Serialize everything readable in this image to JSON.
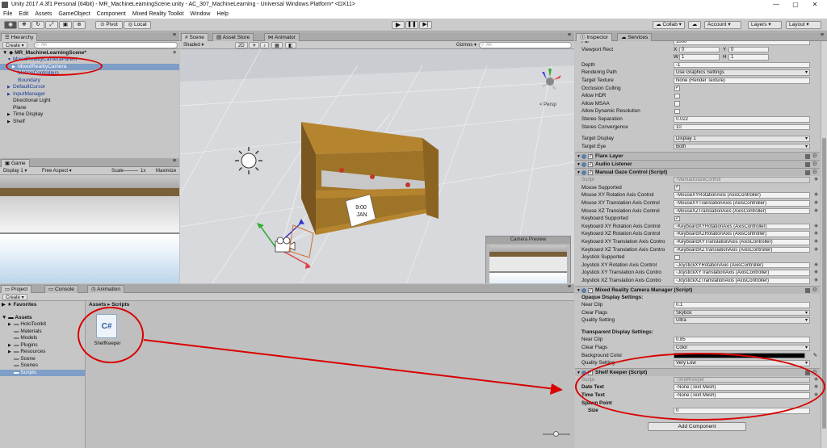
{
  "window": {
    "title": "Unity 2017.4.3f1 Personal (64bit) - MR_MachineLearningScene.unity - AC_307_MachineLearning - Universal Windows Platform* <DX11>",
    "controls": [
      "—",
      "▢",
      "✕"
    ]
  },
  "menubar": [
    "File",
    "Edit",
    "Assets",
    "GameObject",
    "Component",
    "Mixed Reality Toolkit",
    "Window",
    "Help"
  ],
  "toolbar": {
    "pivot": "Pivot",
    "local": "Local",
    "collab": "Collab ▾",
    "account": "Account",
    "layers": "Layers",
    "layout": "Layout"
  },
  "hierarchy": {
    "tab": "Hierarchy",
    "create": "Create ▾",
    "search_placeholder": "All",
    "scene": "MR_MachineLearningScene*",
    "items": [
      {
        "label": "MixedRealityCameraParent",
        "indent": 1,
        "blue": true,
        "arrow": "▼"
      },
      {
        "label": "MixedRealityCamera",
        "indent": 2,
        "blue": true,
        "arrow": "▶",
        "selected": true
      },
      {
        "label": "MotionControllers",
        "indent": 2,
        "blue": true,
        "arrow": ""
      },
      {
        "label": "Boundary",
        "indent": 2,
        "blue": true,
        "arrow": ""
      },
      {
        "label": "DefaultCursor",
        "indent": 1,
        "blue": true,
        "arrow": "▶"
      },
      {
        "label": "InputManager",
        "indent": 1,
        "blue": true,
        "arrow": "▶"
      },
      {
        "label": "Directional Light",
        "indent": 1,
        "blue": false,
        "arrow": ""
      },
      {
        "label": "Plane",
        "indent": 1,
        "blue": false,
        "arrow": ""
      },
      {
        "label": "Time Display",
        "indent": 1,
        "blue": false,
        "arrow": "▶"
      },
      {
        "label": "Shelf",
        "indent": 1,
        "blue": false,
        "arrow": "▶"
      }
    ]
  },
  "game": {
    "tab": "Game",
    "display": "Display 1",
    "aspect": "Free Aspect",
    "scale_label": "Scale",
    "scale_value": "1x",
    "maximize": "Maximize"
  },
  "scene": {
    "tabs": [
      "Scene",
      "Asset Store",
      "Animator"
    ],
    "shaded": "Shaded",
    "mode_2d": "2D",
    "gizmos": "Gizmos ▾",
    "search_placeholder": "All",
    "sign_time": "9:00",
    "sign_month": "JAN",
    "camera_preview": "Camera Preview",
    "persp": "< Persp"
  },
  "project": {
    "tabs": [
      "Project",
      "Console",
      "Animation"
    ],
    "create": "Create ▾",
    "favorites": "Favorites",
    "assets": "Assets",
    "folders": [
      "HoloToolkit",
      "Materials",
      "Models",
      "Plugins",
      "Resources",
      "Scene",
      "Scenes",
      "Scripts"
    ],
    "breadcrumb": "Assets ▸ Scripts",
    "file_name": "ShelfKeeper",
    "file_glyph": "C#"
  },
  "inspector": {
    "tabs": [
      "Inspector",
      "Services"
    ],
    "top_rows": [
      {
        "label": "Far",
        "value": "1000",
        "type": "text"
      },
      {
        "label": "Viewport Rect",
        "value": "",
        "type": "rect"
      },
      {
        "label": "Depth",
        "value": "-1",
        "type": "text"
      },
      {
        "label": "Rendering Path",
        "value": "Use Graphics Settings",
        "type": "drop"
      },
      {
        "label": "Target Texture",
        "value": "None (Render Texture)",
        "type": "text"
      },
      {
        "label": "Occlusion Culling",
        "value": "✓",
        "type": "check"
      },
      {
        "label": "Allow HDR",
        "value": "",
        "type": "check"
      },
      {
        "label": "Allow MSAA",
        "value": "",
        "type": "check"
      },
      {
        "label": "Allow Dynamic Resolution",
        "value": "",
        "type": "check"
      },
      {
        "label": "Stereo Separation",
        "value": "0.022",
        "type": "text"
      },
      {
        "label": "Stereo Convergence",
        "value": "10",
        "type": "text"
      },
      {
        "label": "",
        "value": "",
        "type": "gap"
      },
      {
        "label": "Target Display",
        "value": "Display 1",
        "type": "drop"
      },
      {
        "label": "Target Eye",
        "value": "Both",
        "type": "drop"
      }
    ],
    "viewport": {
      "x_label": "X",
      "x": "0",
      "y_label": "Y",
      "y": "0",
      "w_label": "W",
      "w": "1",
      "h_label": "H",
      "h": "1"
    },
    "flare_layer": "Flare Layer",
    "audio_listener": "Audio Listener",
    "gaze_title": "Manual Gaze Control (Script)",
    "gaze_rows": [
      {
        "label": "Script",
        "value": "ManualGazeControl",
        "type": "script"
      },
      {
        "label": "Mouse Supported",
        "value": "✓",
        "type": "check"
      },
      {
        "label": "Mouse XY Rotation Axis Control",
        "value": "MouseXYRotationAxis (AxisController)",
        "type": "obj"
      },
      {
        "label": "Mouse XY Translation Axis Control",
        "value": "MouseXYTranslationAxis (AxisController)",
        "type": "obj"
      },
      {
        "label": "Mouse XZ Translation Axis Control",
        "value": "MouseXZTranslationAxis (AxisController)",
        "type": "obj"
      },
      {
        "label": "Keyboard Supported",
        "value": "✓",
        "type": "check"
      },
      {
        "label": "Keyboard XY Rotation Axis Control",
        "value": "KeyboardXYRotationAxis (AxisController)",
        "type": "obj"
      },
      {
        "label": "Keyboard XZ Rotation Axis Control",
        "value": "KeyboardXZRotationAxis (AxisController)",
        "type": "obj"
      },
      {
        "label": "Keyboard XY Translation Axis Contro",
        "value": "KeyboardXYTranslationAxis (AxisController)",
        "type": "obj"
      },
      {
        "label": "Keyboard XZ Translation Axis Contro",
        "value": "KeyboardXZTranslationAxis (AxisController)",
        "type": "obj"
      },
      {
        "label": "Joystick Supported",
        "value": "",
        "type": "check"
      },
      {
        "label": "Joystick XY Rotation Axis Control",
        "value": "JoystickXYRotationAxis (AxisController)",
        "type": "obj"
      },
      {
        "label": "Joystick XY Translation Axis Contro",
        "value": "JoystickXYTranslationAxis (AxisController)",
        "type": "obj"
      },
      {
        "label": "Joystick XZ Translation Axis Contro",
        "value": "JoystickXZTranslationAxis (AxisController)",
        "type": "obj"
      }
    ],
    "mrcm_title": "Mixed Reality Camera Manager (Script)",
    "mrcm_rows": [
      {
        "label": "Opaque Display Settings:",
        "value": "",
        "type": "section"
      },
      {
        "label": "Near Clip",
        "value": "0.1",
        "type": "text"
      },
      {
        "label": "Clear Flags",
        "value": "Skybox",
        "type": "drop"
      },
      {
        "label": "Quality Setting",
        "value": "Ultra",
        "type": "drop"
      },
      {
        "label": "",
        "value": "",
        "type": "gap"
      },
      {
        "label": "Transparent Display Settings:",
        "value": "",
        "type": "section"
      },
      {
        "label": "Near Clip",
        "value": "0.85",
        "type": "text"
      },
      {
        "label": "Clear Flags",
        "value": "Color",
        "type": "drop"
      },
      {
        "label": "Background Color",
        "value": "",
        "type": "color"
      },
      {
        "label": "Quality Setting",
        "value": "Very Low",
        "type": "drop"
      }
    ],
    "shelf_title": "Shelf Keeper (Script)",
    "shelf_rows": [
      {
        "label": "Script",
        "value": "ShelfKeeper",
        "type": "script"
      },
      {
        "label": "Date Text",
        "value": "None (Text Mesh)",
        "type": "obj"
      },
      {
        "label": "Time Text",
        "value": "None (Text Mesh)",
        "type": "obj"
      },
      {
        "label": "Spawn Point",
        "value": "",
        "type": "section"
      },
      {
        "label": "Size",
        "value": "0",
        "type": "text"
      }
    ],
    "add_component": "Add Component"
  }
}
